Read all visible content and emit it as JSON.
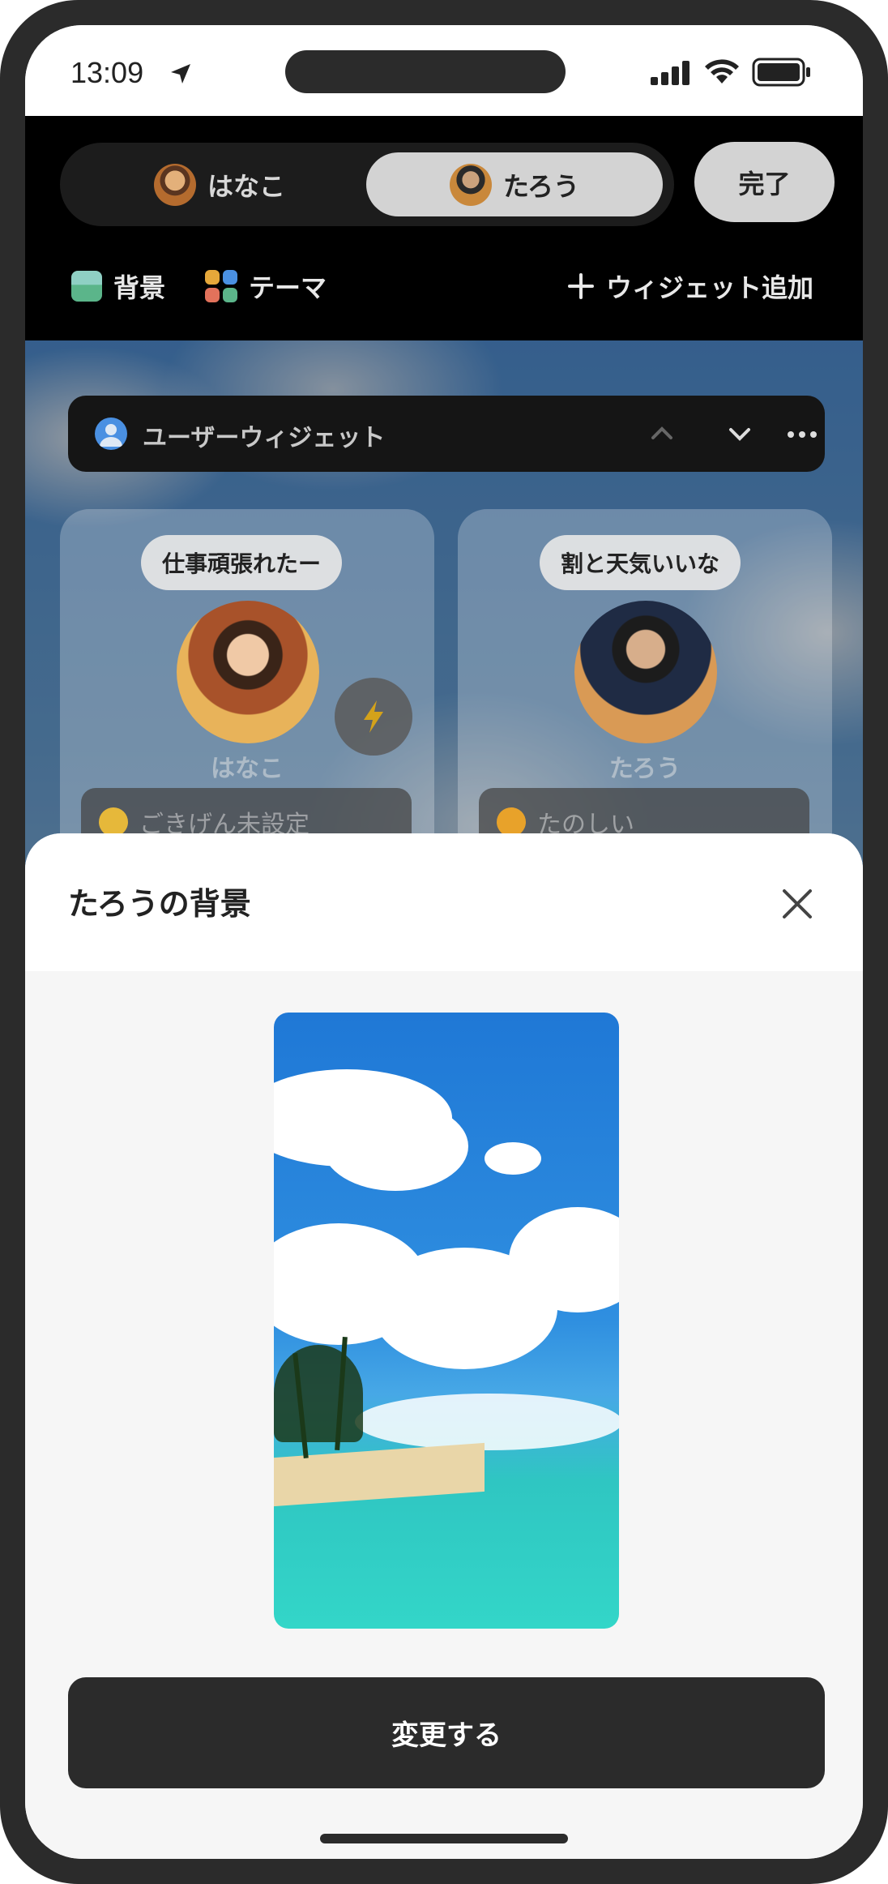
{
  "status_bar": {
    "time": "13:09"
  },
  "header": {
    "users": [
      {
        "name": "はなこ",
        "selected": false
      },
      {
        "name": "たろう",
        "selected": true
      }
    ],
    "done_label": "完了",
    "tools": {
      "background": "背景",
      "theme": "テーマ",
      "add_widget": "ウィジェット追加"
    }
  },
  "widget_bar": {
    "title": "ユーザーウィジェット"
  },
  "cards": [
    {
      "bubble": "仕事頑張れたー",
      "name": "はなこ",
      "mood": "ごきげん未設定"
    },
    {
      "bubble": "割と天気いいな",
      "name": "たろう",
      "mood": "たのしい"
    }
  ],
  "sheet": {
    "title": "たろうの背景",
    "change_button": "変更する"
  },
  "colors": {
    "accent_dark": "#2b2b2b",
    "sheet_bg": "#f6f6f6"
  }
}
